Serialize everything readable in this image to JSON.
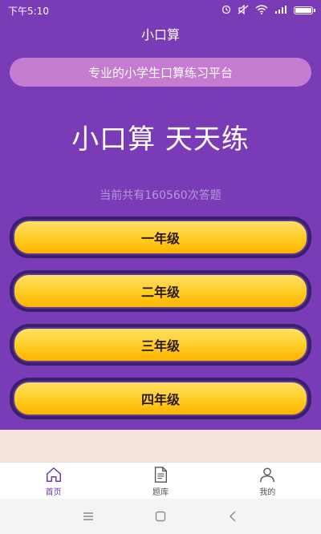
{
  "status_bar": {
    "time": "下午5:10"
  },
  "header": {
    "title": "小口算"
  },
  "banner": {
    "subtitle": "专业的小学生口算练习平台"
  },
  "hero": {
    "title": "小口算 天天练",
    "counter": "当前共有160560次答题"
  },
  "grades": [
    {
      "label": "一年级"
    },
    {
      "label": "二年级"
    },
    {
      "label": "三年级"
    },
    {
      "label": "四年级"
    }
  ],
  "tabbar": {
    "tabs": [
      {
        "label": "首页",
        "icon": "home-icon",
        "active": true
      },
      {
        "label": "题库",
        "icon": "document-icon",
        "active": false
      },
      {
        "label": "我的",
        "icon": "user-icon",
        "active": false
      }
    ]
  },
  "colors": {
    "primary": "#7a3bb6",
    "pill": "#c57bd0",
    "button": "#ffcc22",
    "active_tab": "#6b35b0"
  }
}
